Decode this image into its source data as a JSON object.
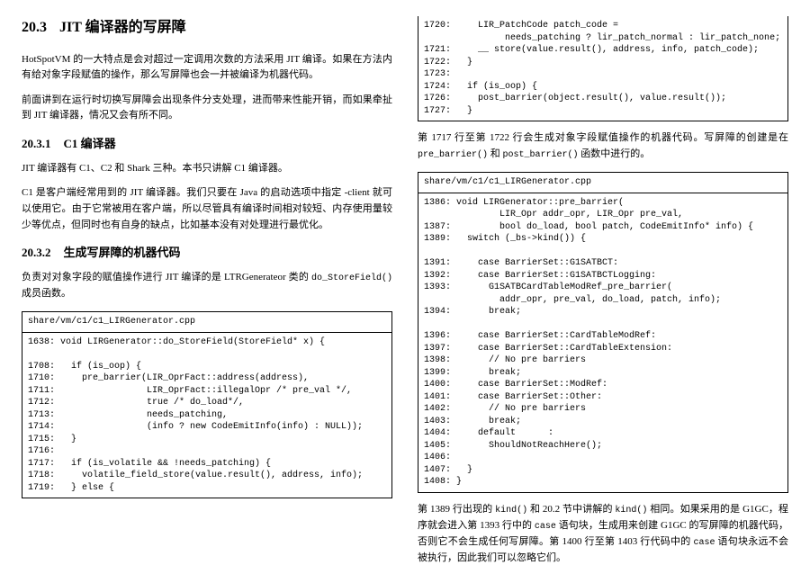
{
  "left": {
    "sec_no": "20.3",
    "sec_title": "JIT 编译器的写屏障",
    "p1": "HotSpotVM 的一大特点是会对超过一定调用次数的方法采用 JIT 编译。如果在方法内有给对象字段赋值的操作，那么写屏障也会一并被编译为机器代码。",
    "p2": "前面讲到在运行时切换写屏障会出现条件分支处理，进而带来性能开销，而如果牵扯到 JIT 编译器，情况又会有所不同。",
    "sub1_no": "20.3.1",
    "sub1_title": "C1 编译器",
    "p3": "JIT 编译器有 C1、C2 和 Shark 三种。本书只讲解 C1 编译器。",
    "p4": "C1 是客户端经常用到的 JIT 编译器。我们只要在 Java 的启动选项中指定 -client 就可以使用它。由于它常被用在客户端，所以尽管具有编译时间相对较短、内存使用量较少等优点，但同时也有自身的缺点，比如基本没有对处理进行最优化。",
    "sub2_no": "20.3.2",
    "sub2_title": "生成写屏障的机器代码",
    "p5_a": "负责对对象字段的赋值操作进行 JIT 编译的是 LTRGenerateor 类的 ",
    "p5_code": "do_StoreField()",
    "p5_b": " 成员函数。",
    "code1_path": "share/vm/c1/c1_LIRGenerator.cpp",
    "code1_body": "1638: void LIRGenerator::do_StoreField(StoreField* x) {\n\n1708:   if (is_oop) {\n1710:     pre_barrier(LIR_OprFact::address(address),\n1711:                 LIR_OprFact::illegalOpr /* pre_val */,\n1712:                 true /* do_load*/,\n1713:                 needs_patching,\n1714:                 (info ? new CodeEmitInfo(info) : NULL));\n1715:   }\n1716:\n1717:   if (is_volatile && !needs_patching) {\n1718:     volatile_field_store(value.result(), address, info);\n1719:   } else {"
  },
  "right": {
    "code_top": "1720:     LIR_PatchCode patch_code =\n               needs_patching ? lir_patch_normal : lir_patch_none;\n1721:     __ store(value.result(), address, info, patch_code);\n1722:   }\n1723:\n1724:   if (is_oop) {\n1726:     post_barrier(object.result(), value.result());\n1727:   }",
    "p1_a": "第 1717 行至第 1722 行会生成对象字段赋值操作的机器代码。写屏障的创建是在 ",
    "p1_c1": "pre_barrier()",
    "p1_b": " 和 ",
    "p1_c2": "post_barrier()",
    "p1_c": " 函数中进行的。",
    "code2_path": "share/vm/c1/c1_LIRGenerator.cpp",
    "code2_body": "1386: void LIRGenerator::pre_barrier(\n              LIR_Opr addr_opr, LIR_Opr pre_val,\n1387:         bool do_load, bool patch, CodeEmitInfo* info) {\n1389:   switch (_bs->kind()) {\n\n1391:     case BarrierSet::G1SATBCT:\n1392:     case BarrierSet::G1SATBCTLogging:\n1393:       G1SATBCardTableModRef_pre_barrier(\n              addr_opr, pre_val, do_load, patch, info);\n1394:       break;\n\n1396:     case BarrierSet::CardTableModRef:\n1397:     case BarrierSet::CardTableExtension:\n1398:       // No pre barriers\n1399:       break;\n1400:     case BarrierSet::ModRef:\n1401:     case BarrierSet::Other:\n1402:       // No pre barriers\n1403:       break;\n1404:     default      :\n1405:       ShouldNotReachHere();\n1406:\n1407:   }\n1408: }",
    "p2_a": "第 1389 行出现的 ",
    "p2_c1": "kind()",
    "p2_b": " 和 20.2 节中讲解的 ",
    "p2_c2": "kind()",
    "p2_c": " 相同。如果采用的是 G1GC，程序就会进入第 1393 行中的 ",
    "p2_c3": "case",
    "p2_d": " 语句块，生成用来创建 G1GC 的写屏障的机器代码，否则它不会生成任何写屏障。第 1400 行至第 1403 行代码中的 ",
    "p2_c4": "case",
    "p2_e": " 语句块永远不会被执行，因此我们可以忽略它们。"
  }
}
